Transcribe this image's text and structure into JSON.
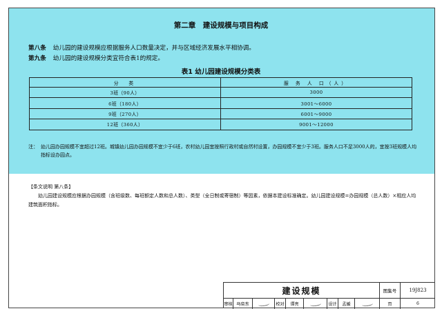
{
  "chapter": {
    "title": "第二章　建设规模与项目构成"
  },
  "articles": [
    {
      "num": "第八条",
      "text": "幼儿园的建设规模应根据服务人口数量决定，并与区域经济发展水平相协调。"
    },
    {
      "num": "第九条",
      "text": "幼儿园的建设规模分类宜符合表1的规定。"
    }
  ],
  "table": {
    "title": "表1  幼儿园建设规模分类表",
    "headers": [
      "分　类",
      "服 务 人 口（人）"
    ],
    "rows": [
      [
        "3班（90人）",
        "3000"
      ],
      [
        "6班（180人）",
        "3001～6000"
      ],
      [
        "9班（270人）",
        "6001～9000"
      ],
      [
        "12班（360人）",
        "9001～12000"
      ]
    ]
  },
  "note": {
    "lead": "注：",
    "text": "幼儿园办园规模不宜超过12班。城镇幼儿园办园规模不宜少于6班，农村幼儿园宜按照行政村或自然村设置，办园规模不宜少于3班。服务人口不足3000人的，宜按3班规模人均指标设办园点。"
  },
  "explanation": {
    "heading": "【条文说明  第八条】",
    "text": "幼儿园建设规模应根据办园规模（含班级数、每班额定人数和总人数）、类型（全日制或寄宿制）等因素，依据本建设标准确定。幼儿园建设规模=办园规模（总人数）×相应人均建筑面积指标。"
  },
  "title_block": {
    "title": "建设规模",
    "atlas_label": "图集号",
    "atlas_number": "19J823",
    "review_label": "审核",
    "reviewer": "马晓东",
    "check_label": "校对",
    "checker": "谭亮",
    "design_label": "设计",
    "designer": "孟媛",
    "page_label": "页",
    "page_number": "6"
  }
}
